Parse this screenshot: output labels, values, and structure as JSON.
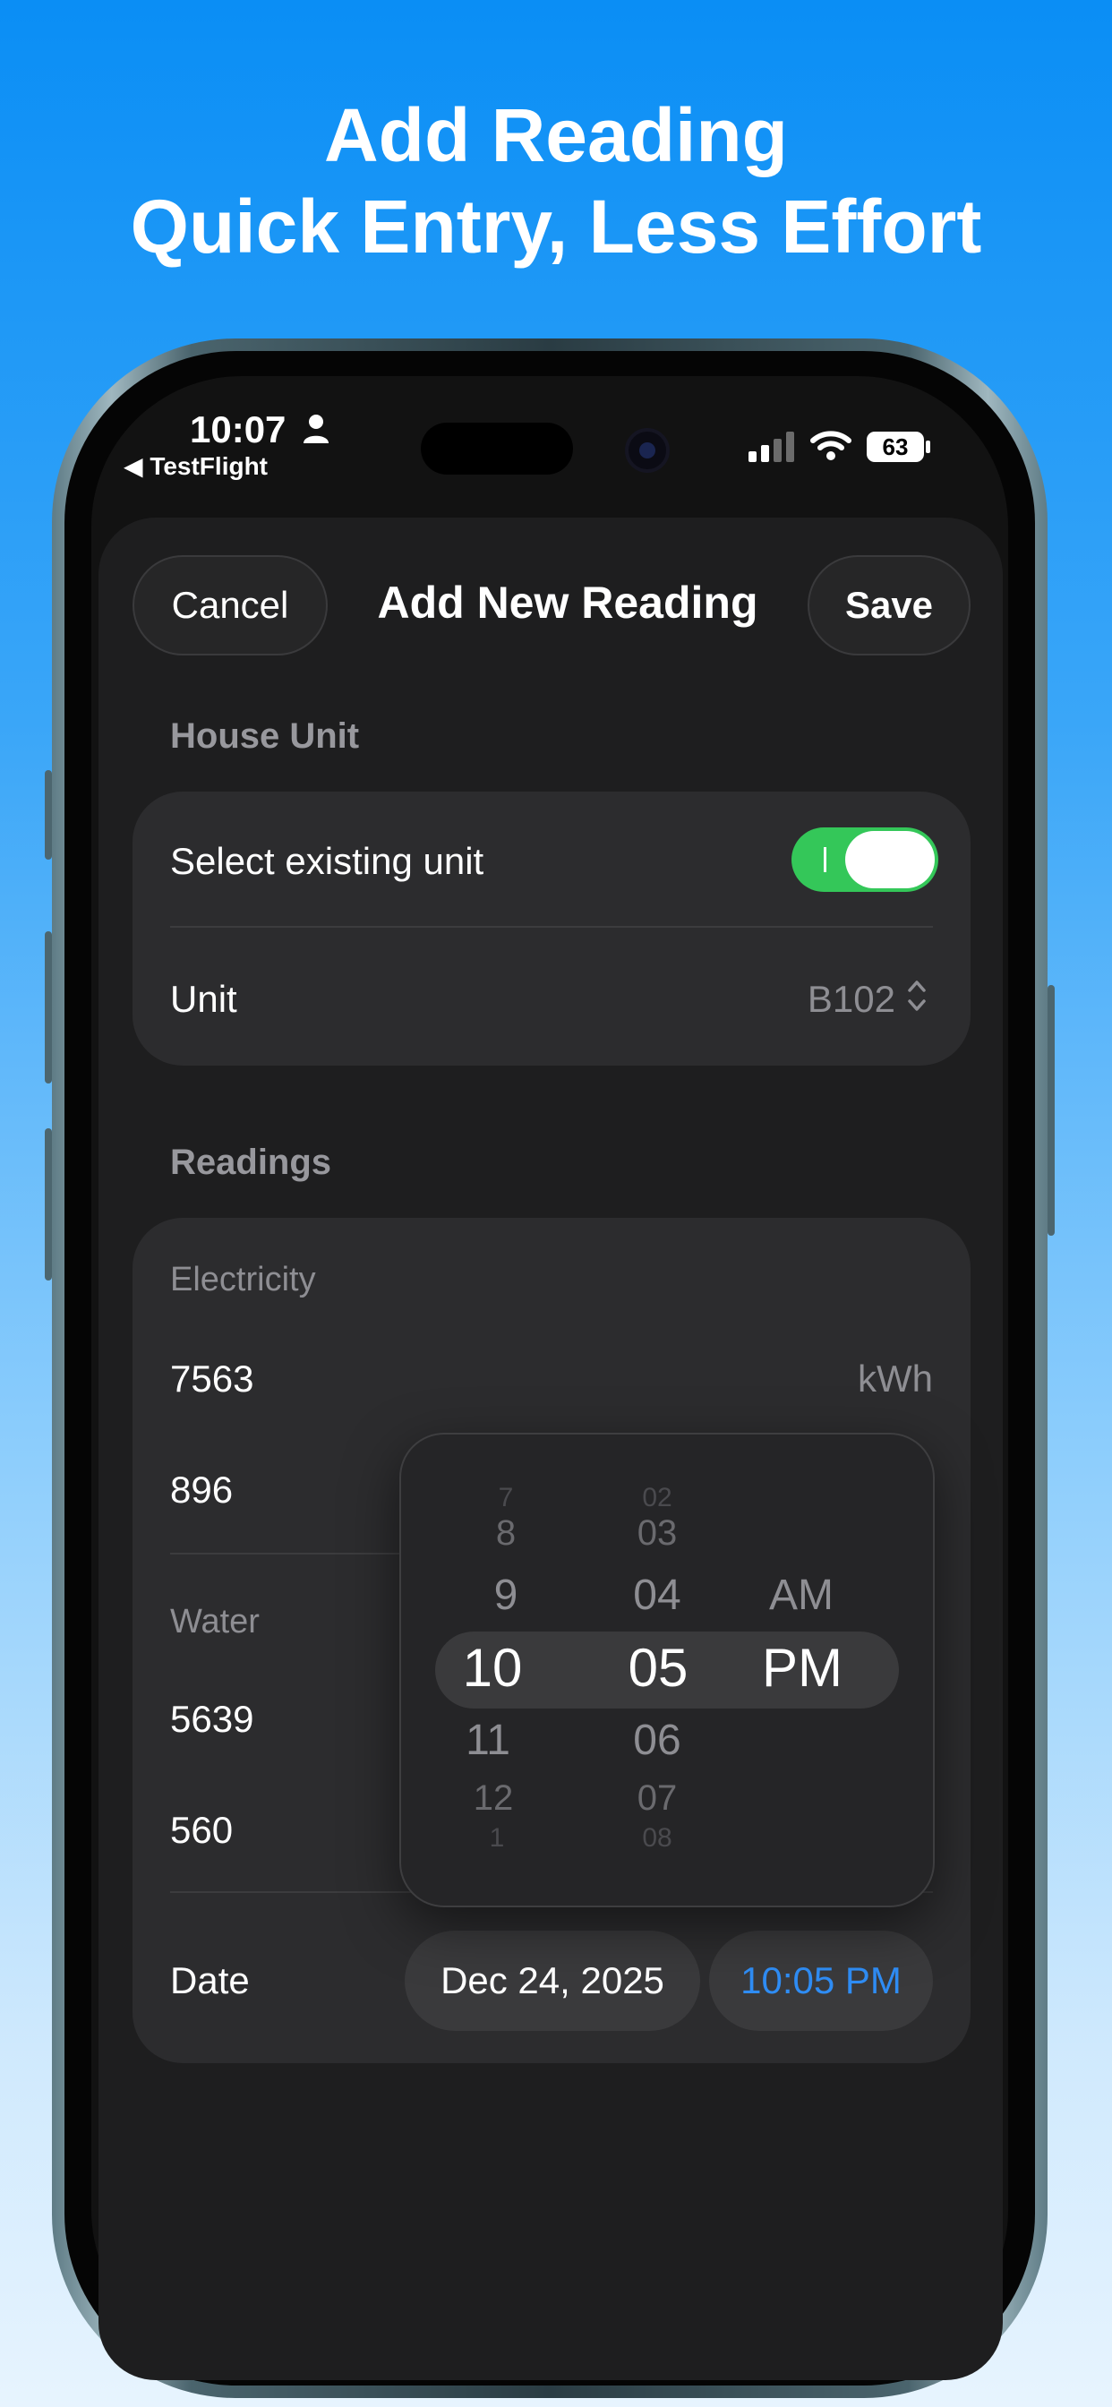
{
  "headline": {
    "line1": "Add Reading",
    "line2": "Quick Entry, Less Effort"
  },
  "status_bar": {
    "time": "10:07",
    "back_app": "◀ TestFlight",
    "battery": "63"
  },
  "nav": {
    "cancel_label": "Cancel",
    "title": "Add New Reading",
    "save_label": "Save"
  },
  "house_unit": {
    "header": "House Unit",
    "select_existing_label": "Select existing unit",
    "select_existing_on": true,
    "unit_label": "Unit",
    "unit_value": "B102"
  },
  "readings": {
    "header": "Readings",
    "electricity_label": "Electricity",
    "electricity_current": "7563",
    "electricity_unit": "kWh",
    "electricity_previous": "896",
    "water_label": "Water",
    "water_current": "5639",
    "water_previous": "560",
    "date_label": "Date",
    "date_value": "Dec 24, 2025",
    "time_value": "10:05 PM"
  },
  "time_picker": {
    "hours": [
      "7",
      "8",
      "9",
      "10",
      "11",
      "12",
      "1"
    ],
    "minutes": [
      "02",
      "03",
      "04",
      "05",
      "06",
      "07",
      "08"
    ],
    "periods": [
      "AM",
      "PM"
    ],
    "selected_hour": "10",
    "selected_minute": "05",
    "selected_period": "PM"
  },
  "colors": {
    "accent_blue": "#2f8df5",
    "toggle_green": "#34c759",
    "background_top": "#0a8ef5",
    "background_bottom": "#e7f4fe"
  }
}
